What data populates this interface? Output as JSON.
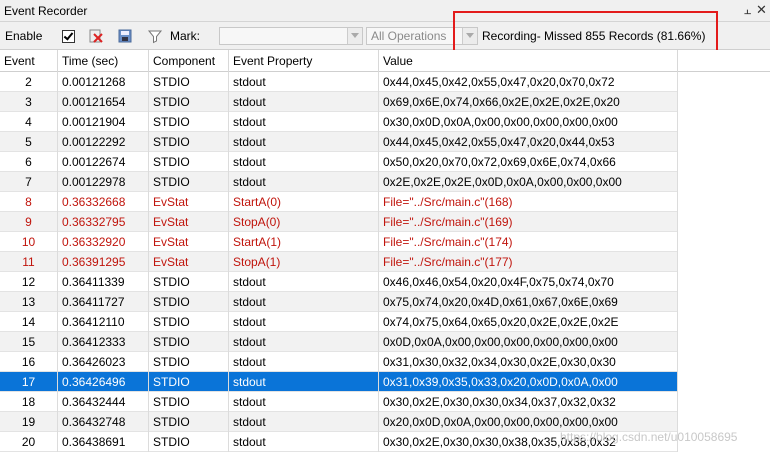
{
  "window": {
    "title": "Event Recorder",
    "pin_icon": "pin-icon",
    "close_icon": "close-icon"
  },
  "toolbar": {
    "enable_label": "Enable",
    "enable_checked": true,
    "mark_label": "Mark:",
    "mark_value": "",
    "operations_value": "All Operations",
    "recording_status": "Recording- Missed 855 Records (81.66%)"
  },
  "columns": [
    "Event",
    "Time (sec)",
    "Component",
    "Event Property",
    "Value"
  ],
  "rows": [
    {
      "event": "2",
      "time": "0.00121268",
      "component": "STDIO",
      "property": "stdout",
      "value": "0x44,0x45,0x42,0x55,0x47,0x20,0x70,0x72"
    },
    {
      "event": "3",
      "time": "0.00121654",
      "component": "STDIO",
      "property": "stdout",
      "value": "0x69,0x6E,0x74,0x66,0x2E,0x2E,0x2E,0x20"
    },
    {
      "event": "4",
      "time": "0.00121904",
      "component": "STDIO",
      "property": "stdout",
      "value": "0x30,0x0D,0x0A,0x00,0x00,0x00,0x00,0x00"
    },
    {
      "event": "5",
      "time": "0.00122292",
      "component": "STDIO",
      "property": "stdout",
      "value": "0x44,0x45,0x42,0x55,0x47,0x20,0x44,0x53"
    },
    {
      "event": "6",
      "time": "0.00122674",
      "component": "STDIO",
      "property": "stdout",
      "value": "0x50,0x20,0x70,0x72,0x69,0x6E,0x74,0x66"
    },
    {
      "event": "7",
      "time": "0.00122978",
      "component": "STDIO",
      "property": "stdout",
      "value": "0x2E,0x2E,0x2E,0x0D,0x0A,0x00,0x00,0x00"
    },
    {
      "event": "8",
      "time": "0.36332668",
      "component": "EvStat",
      "property": "StartA(0)",
      "value": "File=\"../Src/main.c\"(168)"
    },
    {
      "event": "9",
      "time": "0.36332795",
      "component": "EvStat",
      "property": "StopA(0)",
      "value": "File=\"../Src/main.c\"(169)"
    },
    {
      "event": "10",
      "time": "0.36332920",
      "component": "EvStat",
      "property": "StartA(1)",
      "value": "File=\"../Src/main.c\"(174)"
    },
    {
      "event": "11",
      "time": "0.36391295",
      "component": "EvStat",
      "property": "StopA(1)",
      "value": "File=\"../Src/main.c\"(177)"
    },
    {
      "event": "12",
      "time": "0.36411339",
      "component": "STDIO",
      "property": "stdout",
      "value": "0x46,0x46,0x54,0x20,0x4F,0x75,0x74,0x70"
    },
    {
      "event": "13",
      "time": "0.36411727",
      "component": "STDIO",
      "property": "stdout",
      "value": "0x75,0x74,0x20,0x4D,0x61,0x67,0x6E,0x69"
    },
    {
      "event": "14",
      "time": "0.36412110",
      "component": "STDIO",
      "property": "stdout",
      "value": "0x74,0x75,0x64,0x65,0x20,0x2E,0x2E,0x2E"
    },
    {
      "event": "15",
      "time": "0.36412333",
      "component": "STDIO",
      "property": "stdout",
      "value": "0x0D,0x0A,0x00,0x00,0x00,0x00,0x00,0x00"
    },
    {
      "event": "16",
      "time": "0.36426023",
      "component": "STDIO",
      "property": "stdout",
      "value": "0x31,0x30,0x32,0x34,0x30,0x2E,0x30,0x30"
    },
    {
      "event": "17",
      "time": "0.36426496",
      "component": "STDIO",
      "property": "stdout",
      "value": "0x31,0x39,0x35,0x33,0x20,0x0D,0x0A,0x00"
    },
    {
      "event": "18",
      "time": "0.36432444",
      "component": "STDIO",
      "property": "stdout",
      "value": "0x30,0x2E,0x30,0x30,0x34,0x37,0x32,0x32"
    },
    {
      "event": "19",
      "time": "0.36432748",
      "component": "STDIO",
      "property": "stdout",
      "value": "0x20,0x0D,0x0A,0x00,0x00,0x00,0x00,0x00"
    },
    {
      "event": "20",
      "time": "0.36438691",
      "component": "STDIO",
      "property": "stdout",
      "value": "0x30,0x2E,0x30,0x30,0x38,0x35,0x38,0x32"
    }
  ],
  "selected_event": "17",
  "watermark": "https://blog.csdn.net/u010058695",
  "colors": {
    "selection": "#0a74d8",
    "evstat_text": "#c0140c",
    "callout_border": "#e31b1b"
  }
}
